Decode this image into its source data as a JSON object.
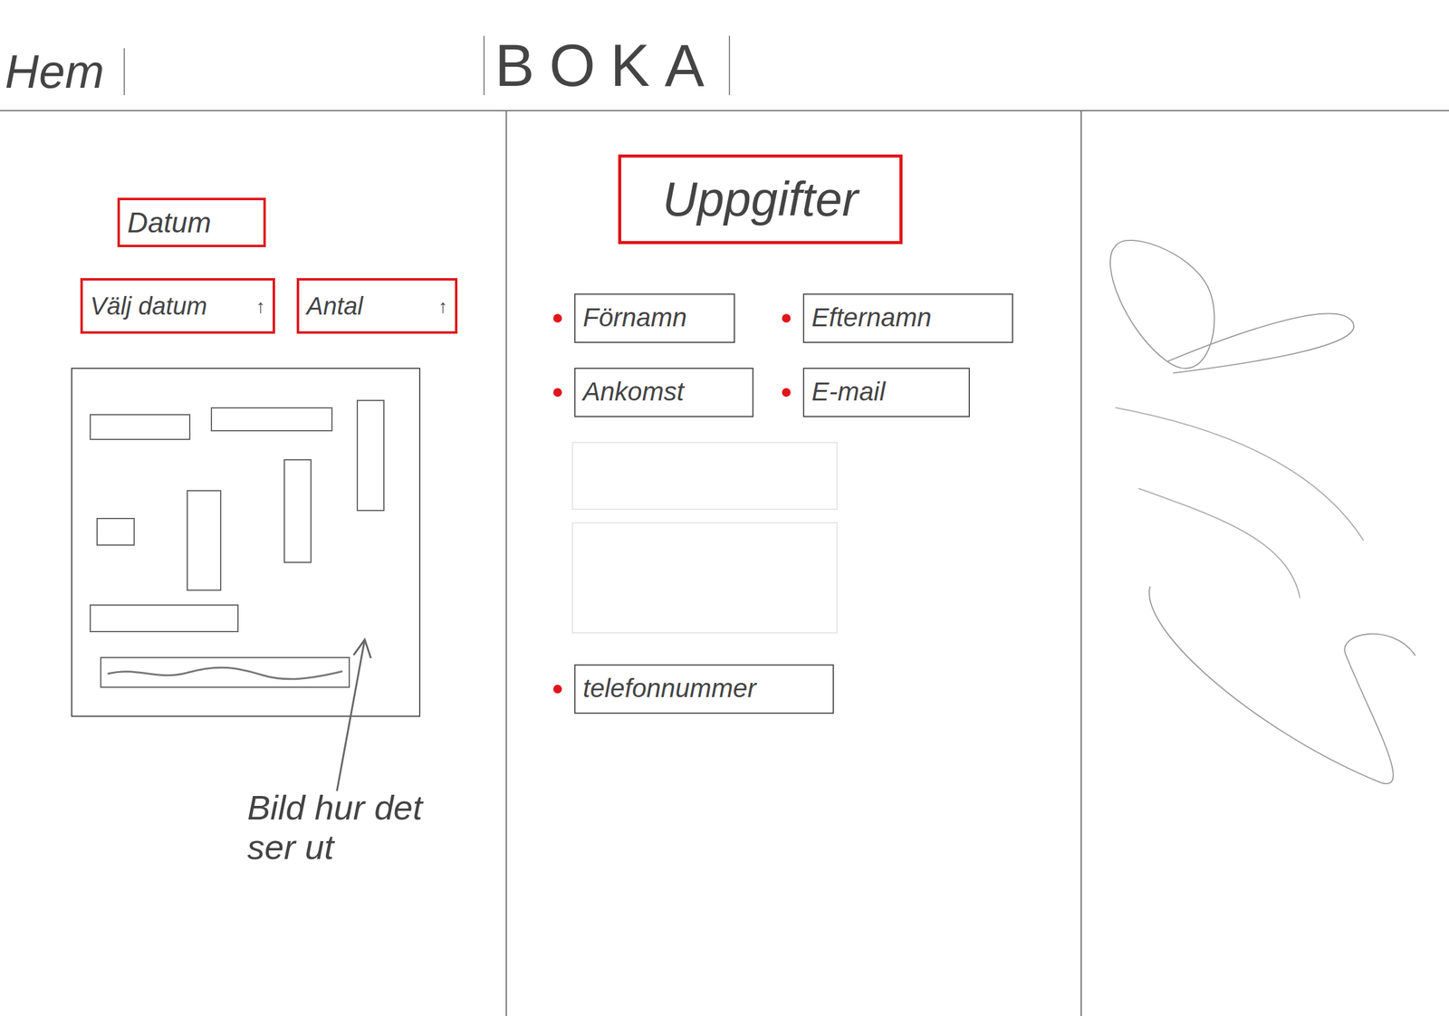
{
  "tabs": [
    "Hem",
    "BOKA"
  ],
  "date_panel": {
    "title": "Datum",
    "selects": [
      {
        "label": "Välj datum",
        "icon": "↑"
      },
      {
        "label": "Antal",
        "icon": "↑"
      }
    ],
    "map": {
      "caption": "Bild hur det ser ut"
    }
  },
  "details_panel": {
    "title": "Uppgifter",
    "fields": [
      {
        "label": "Förnamn",
        "marked": true
      },
      {
        "label": "Efternamn",
        "marked": true
      },
      {
        "label": "Ankomst",
        "marked": true
      },
      {
        "label": "E-mail",
        "marked": true
      },
      {
        "label": "telefonnummer",
        "marked": true
      }
    ]
  }
}
